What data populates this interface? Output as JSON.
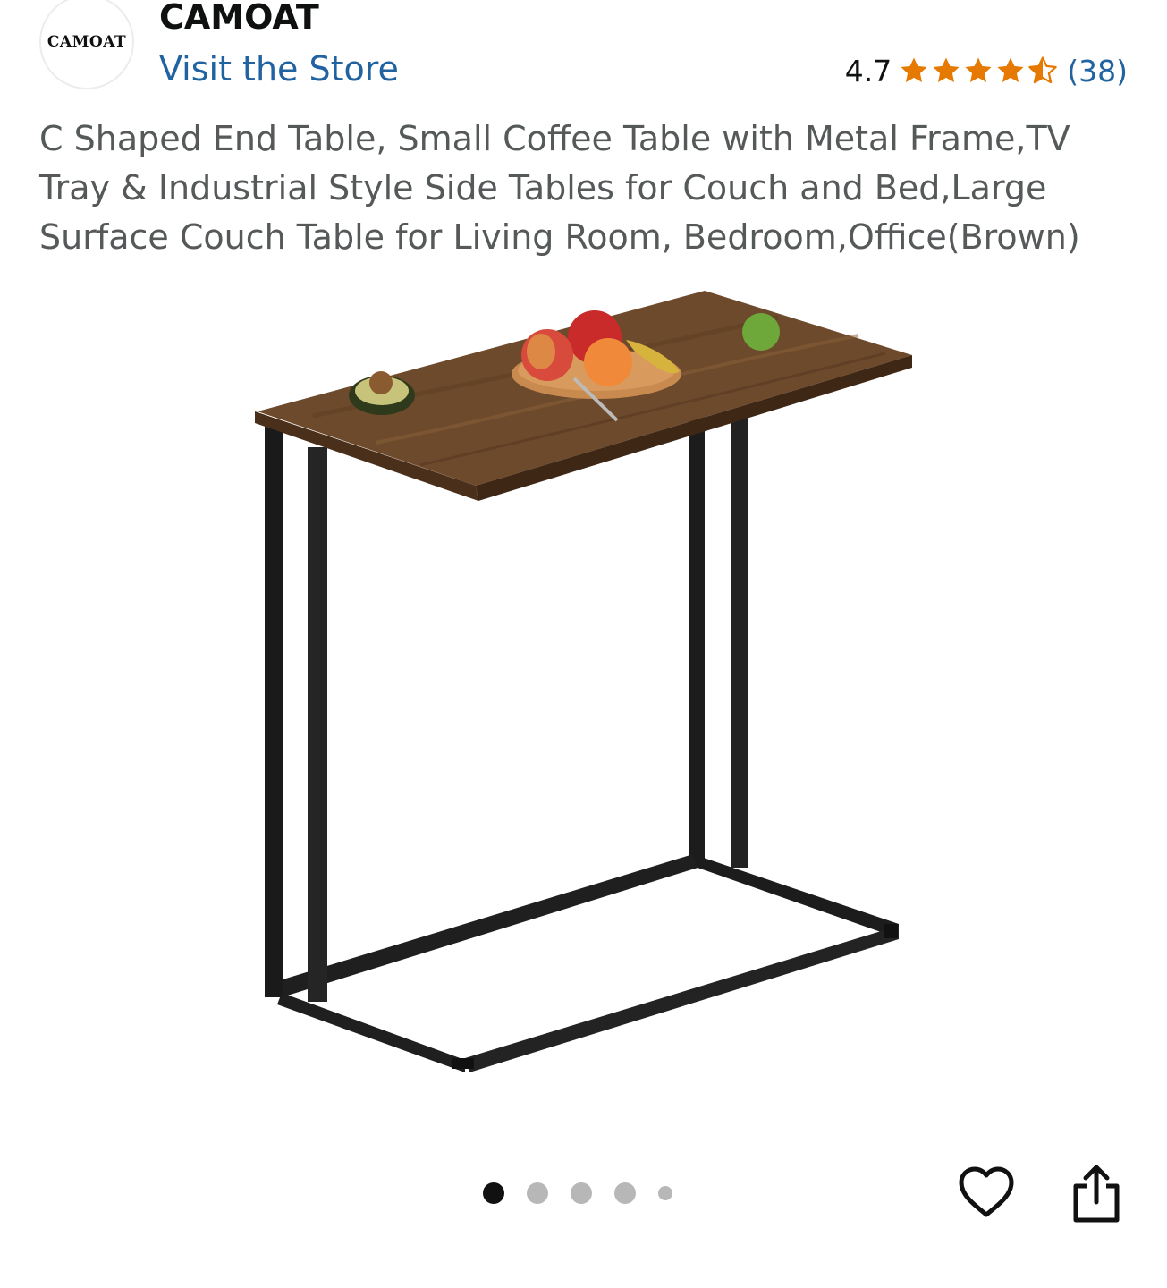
{
  "store": {
    "logo_text": "CAMOAT",
    "brand_name": "CAMOAT",
    "visit_store_label": "Visit the Store"
  },
  "rating": {
    "value": "4.7",
    "stars": 4.5,
    "count_label": "(38)",
    "star_color": "#e67a00"
  },
  "product": {
    "title": "C Shaped End Table, Small Coffee Table with Metal Frame,TV Tray & Industrial Style Side Tables for Couch and Bed,Large Surface Couch Table for Living Room, Bedroom,Office(Brown)"
  },
  "gallery": {
    "image_count": 5,
    "active_index": 0
  },
  "actions": {
    "wishlist_icon": "heart-icon",
    "share_icon": "share-icon"
  },
  "colors": {
    "link": "#2162a1",
    "title_text": "#565959",
    "dot_active": "#111111",
    "dot_inactive": "#b7b7b7"
  }
}
